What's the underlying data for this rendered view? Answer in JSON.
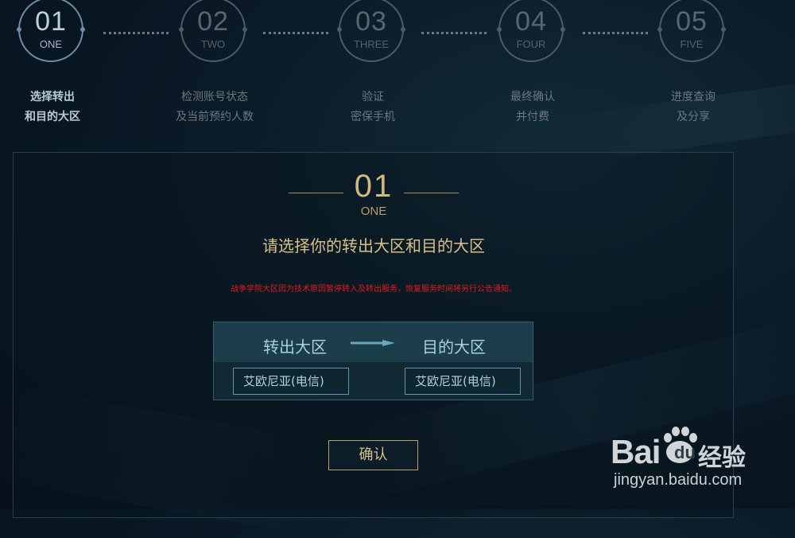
{
  "steps": [
    {
      "num": "01",
      "word": "ONE",
      "line1": "选择转出",
      "line2": "和目的大区",
      "active": true
    },
    {
      "num": "02",
      "word": "TWO",
      "line1": "检测账号状态",
      "line2": "及当前预约人数",
      "active": false
    },
    {
      "num": "03",
      "word": "THREE",
      "line1": "验证",
      "line2": "密保手机",
      "active": false
    },
    {
      "num": "04",
      "word": "FOUR",
      "line1": "最终确认",
      "line2": "并付费",
      "active": false
    },
    {
      "num": "05",
      "word": "FIVE",
      "line1": "进度查询",
      "line2": "及分享",
      "active": false
    }
  ],
  "main": {
    "step_num": "01",
    "step_word": "ONE",
    "title": "请选择你的转出大区和目的大区",
    "notice": "战争学院大区因为技术原因暂停转入及转出服务，恢复服务时间将另行公告通知。",
    "from_label": "转出大区",
    "to_label": "目的大区",
    "from_server": "艾欧尼亚(电信)",
    "to_server": "艾欧尼亚(电信)",
    "confirm": "确认"
  },
  "watermark": {
    "brand_left": "Bai",
    "brand_paw": "du",
    "brand_right": "经验",
    "url": "jingyan.baidu.com"
  },
  "colors": {
    "accent_gold": "#d2ba82",
    "active_step": "#b9d2de",
    "notice_red": "#e11b1b",
    "server_header": "#1c3d4a"
  },
  "icons": {
    "arrow": "right-arrow-icon",
    "paw": "baidu-paw-icon"
  }
}
